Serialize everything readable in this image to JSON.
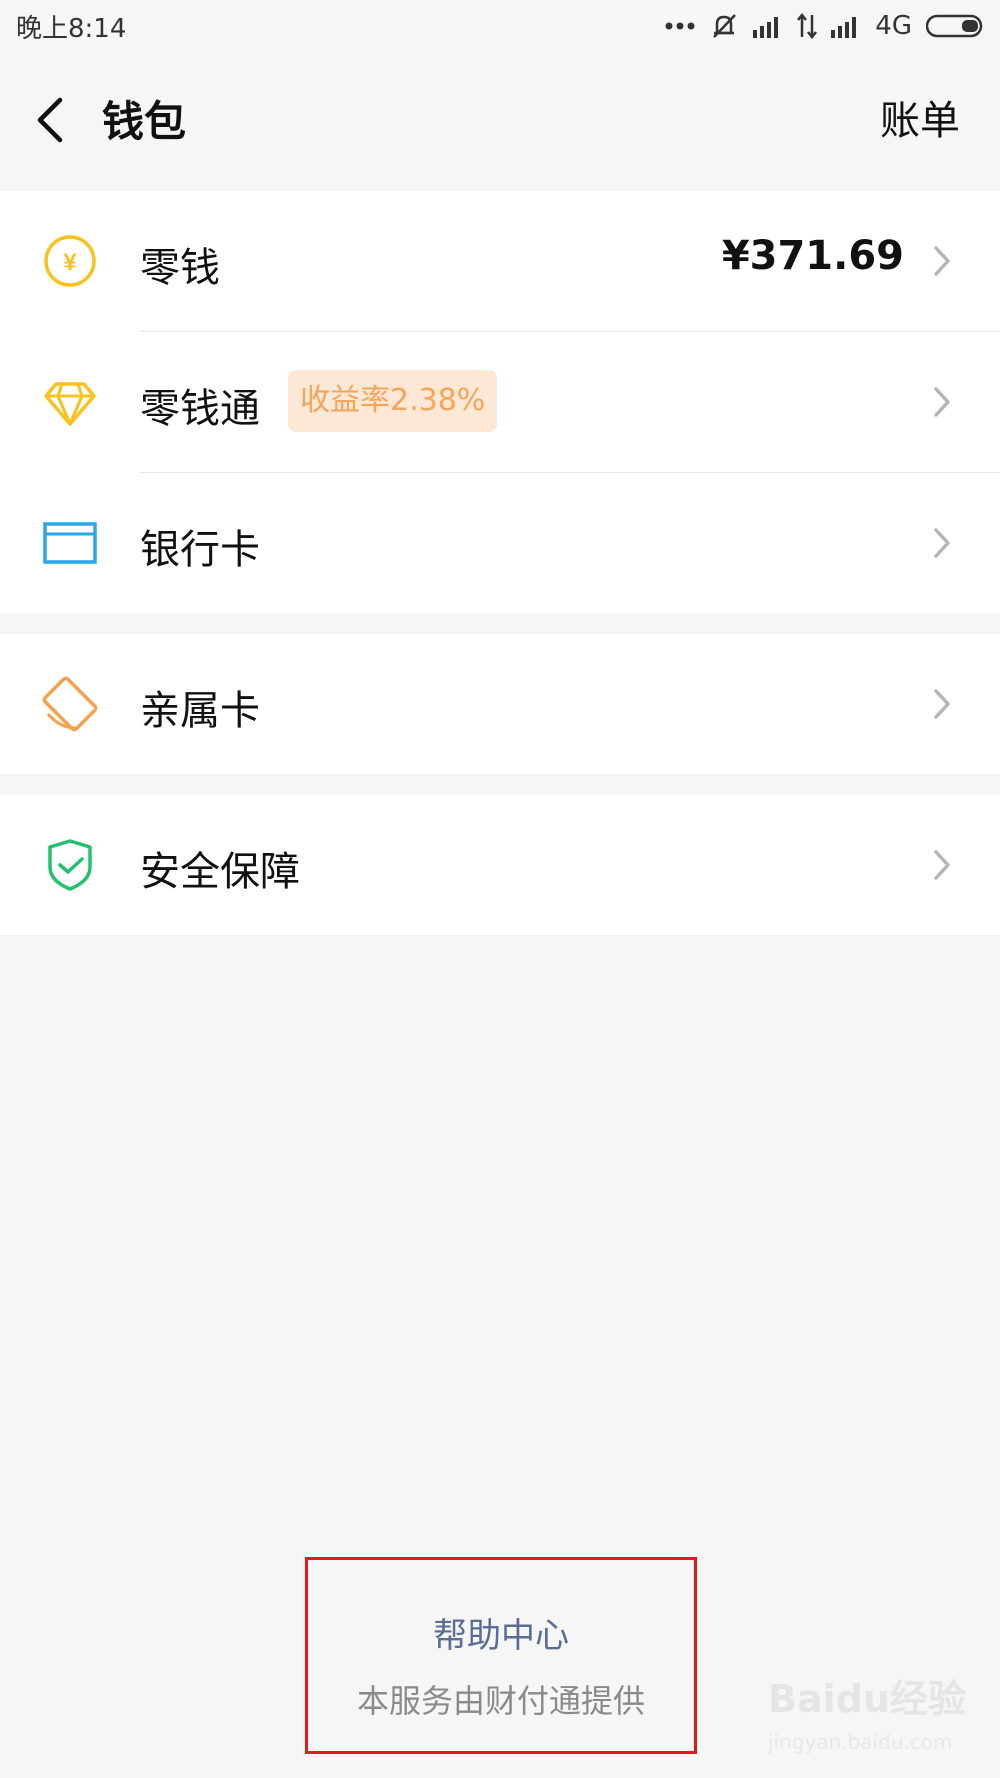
{
  "status_bar": {
    "time": "晚上8:14",
    "network": "4G",
    "icons": [
      "more-dots-icon",
      "mute-icon",
      "signal-icon",
      "data-arrows-icon",
      "signal-icon",
      "battery-icon"
    ]
  },
  "nav": {
    "title": "钱包",
    "right": "账单",
    "back_icon": "back-arrow-icon"
  },
  "groups": [
    {
      "items": [
        {
          "id": "lingqian",
          "label": "零钱",
          "value": "¥371.69",
          "icon": "yuan-coin-icon",
          "color": "#f8c21f"
        },
        {
          "id": "lingqiantong",
          "label": "零钱通",
          "badge": "收益率2.38%",
          "icon": "diamond-icon",
          "color": "#f8c21f"
        },
        {
          "id": "bankcard",
          "label": "银行卡",
          "icon": "bank-card-icon",
          "color": "#2aa6ea"
        }
      ]
    },
    {
      "items": [
        {
          "id": "family",
          "label": "亲属卡",
          "icon": "family-card-icon",
          "color": "#f6a14d"
        }
      ]
    },
    {
      "items": [
        {
          "id": "security",
          "label": "安全保障",
          "icon": "shield-check-icon",
          "color": "#23c06e"
        }
      ]
    }
  ],
  "footer": {
    "help": "帮助中心",
    "provider": "本服务由财付通提供",
    "highlight_color": "#e01b1b"
  },
  "watermark": {
    "brand": "Baidu经验",
    "url": "jingyan.baidu.com"
  }
}
